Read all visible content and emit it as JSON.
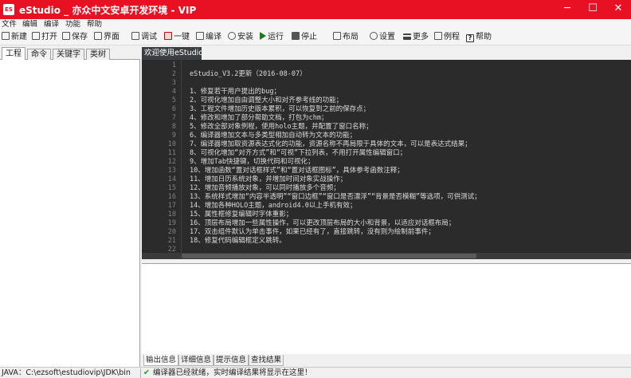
{
  "window": {
    "icon_text": "ES",
    "title": "eStudio _ 亦众中文安卓开发环境 - VIP",
    "minimize": "─",
    "maximize": "☐",
    "close": "✕"
  },
  "menu": [
    "文件",
    "编辑",
    "编译",
    "功能",
    "帮助"
  ],
  "toolbar": [
    {
      "label": "新建",
      "icon": "new-file-icon"
    },
    {
      "label": "打开",
      "icon": "open-folder-icon"
    },
    {
      "label": "保存",
      "icon": "save-icon"
    },
    {
      "label": "界面",
      "icon": "designer-icon"
    },
    {
      "label": "调试",
      "icon": "debug-icon"
    },
    {
      "label": "一键",
      "icon": "one-click-icon"
    },
    {
      "label": "编译",
      "icon": "compile-icon"
    },
    {
      "label": "安装",
      "icon": "install-icon"
    },
    {
      "label": "运行",
      "icon": "run-icon"
    },
    {
      "label": "停止",
      "icon": "stop-icon"
    },
    {
      "label": "布局",
      "icon": "layout-icon"
    },
    {
      "label": "设置",
      "icon": "settings-icon"
    },
    {
      "label": "更多",
      "icon": "more-icon"
    },
    {
      "label": "例程",
      "icon": "examples-icon"
    },
    {
      "label": "帮助",
      "icon": "help-icon"
    }
  ],
  "left_tabs": [
    "工程",
    "命令",
    "关键字",
    "类树"
  ],
  "doc_tab": "欢迎使用eStudio",
  "editor": {
    "line_numbers": [
      "1",
      "2",
      "3",
      "4",
      "5",
      "6",
      "7",
      "8",
      "9",
      "10",
      "11",
      "12",
      "13",
      "14",
      "15",
      "16",
      "17",
      "18",
      "19",
      "20",
      "21",
      "22"
    ],
    "lines": [
      "",
      "eStudio_V3.2更新（2016-08-07）",
      "",
      "1、修复若干用户提出的bug；",
      "2、可视化增加自由调整大小和对齐参考线的功能；",
      "3、工程文件增加历史版本累积，可以恢复到之前的保存点；",
      "4、修改和增加了部分帮助文档，打包为chm；",
      "5、修改全部对象例程，使用holo主题，并配置了窗口名称；",
      "6、编译器增加文本与多类型相加自动转为文本的功能；",
      "7、编译器增加取资源表达式化的功能，资源名称不再局限于具体的文本，可以是表达式结果；",
      "8、可视化增加“对齐方式”和“可视”下拉列表，不用打开属性编辑窗口；",
      "9、增加Tab快捷键，切换代码和可视化；",
      "10、增加函数“置对话框样式”和“置对话框图标”，具体参考函数注释；",
      "11、增加日历系统对象，并增加时间对象实战操作；",
      "12、增加音频播放对象，可以同时播放多个音频；",
      "13、系统样式增加“内容半透明”“窗口边框”“窗口是否漂浮”“背景是否模糊”等选项，可供测试；",
      "14、增加各种HOLO主题，android4.0以上手机有效；",
      "15、属性框修复编辑时字体重影；",
      "16、顶层布局增加一些属性操作，可以更改顶层布局的大小和背景，以适应对话框布局；",
      "17、双击组件默认为单击事件，如果已经有了，直接跳转，没有则为绘制前事件；",
      "18、修复代码编辑框定义跳转。",
      ""
    ]
  },
  "output_tabs": [
    "输出信息",
    "详细信息",
    "提示信息",
    "查找结果"
  ],
  "status": {
    "java": "JAVA：C:\\ezsoft\\estudiovip\\JDK\\bin",
    "check": "✔",
    "message": "编译器已经就绪，实时编译结果将显示在这里！"
  },
  "colors": {
    "titlebar": "#e81123",
    "editor_bg": "#2b2b2b",
    "ok_green": "#1a9a1a"
  }
}
